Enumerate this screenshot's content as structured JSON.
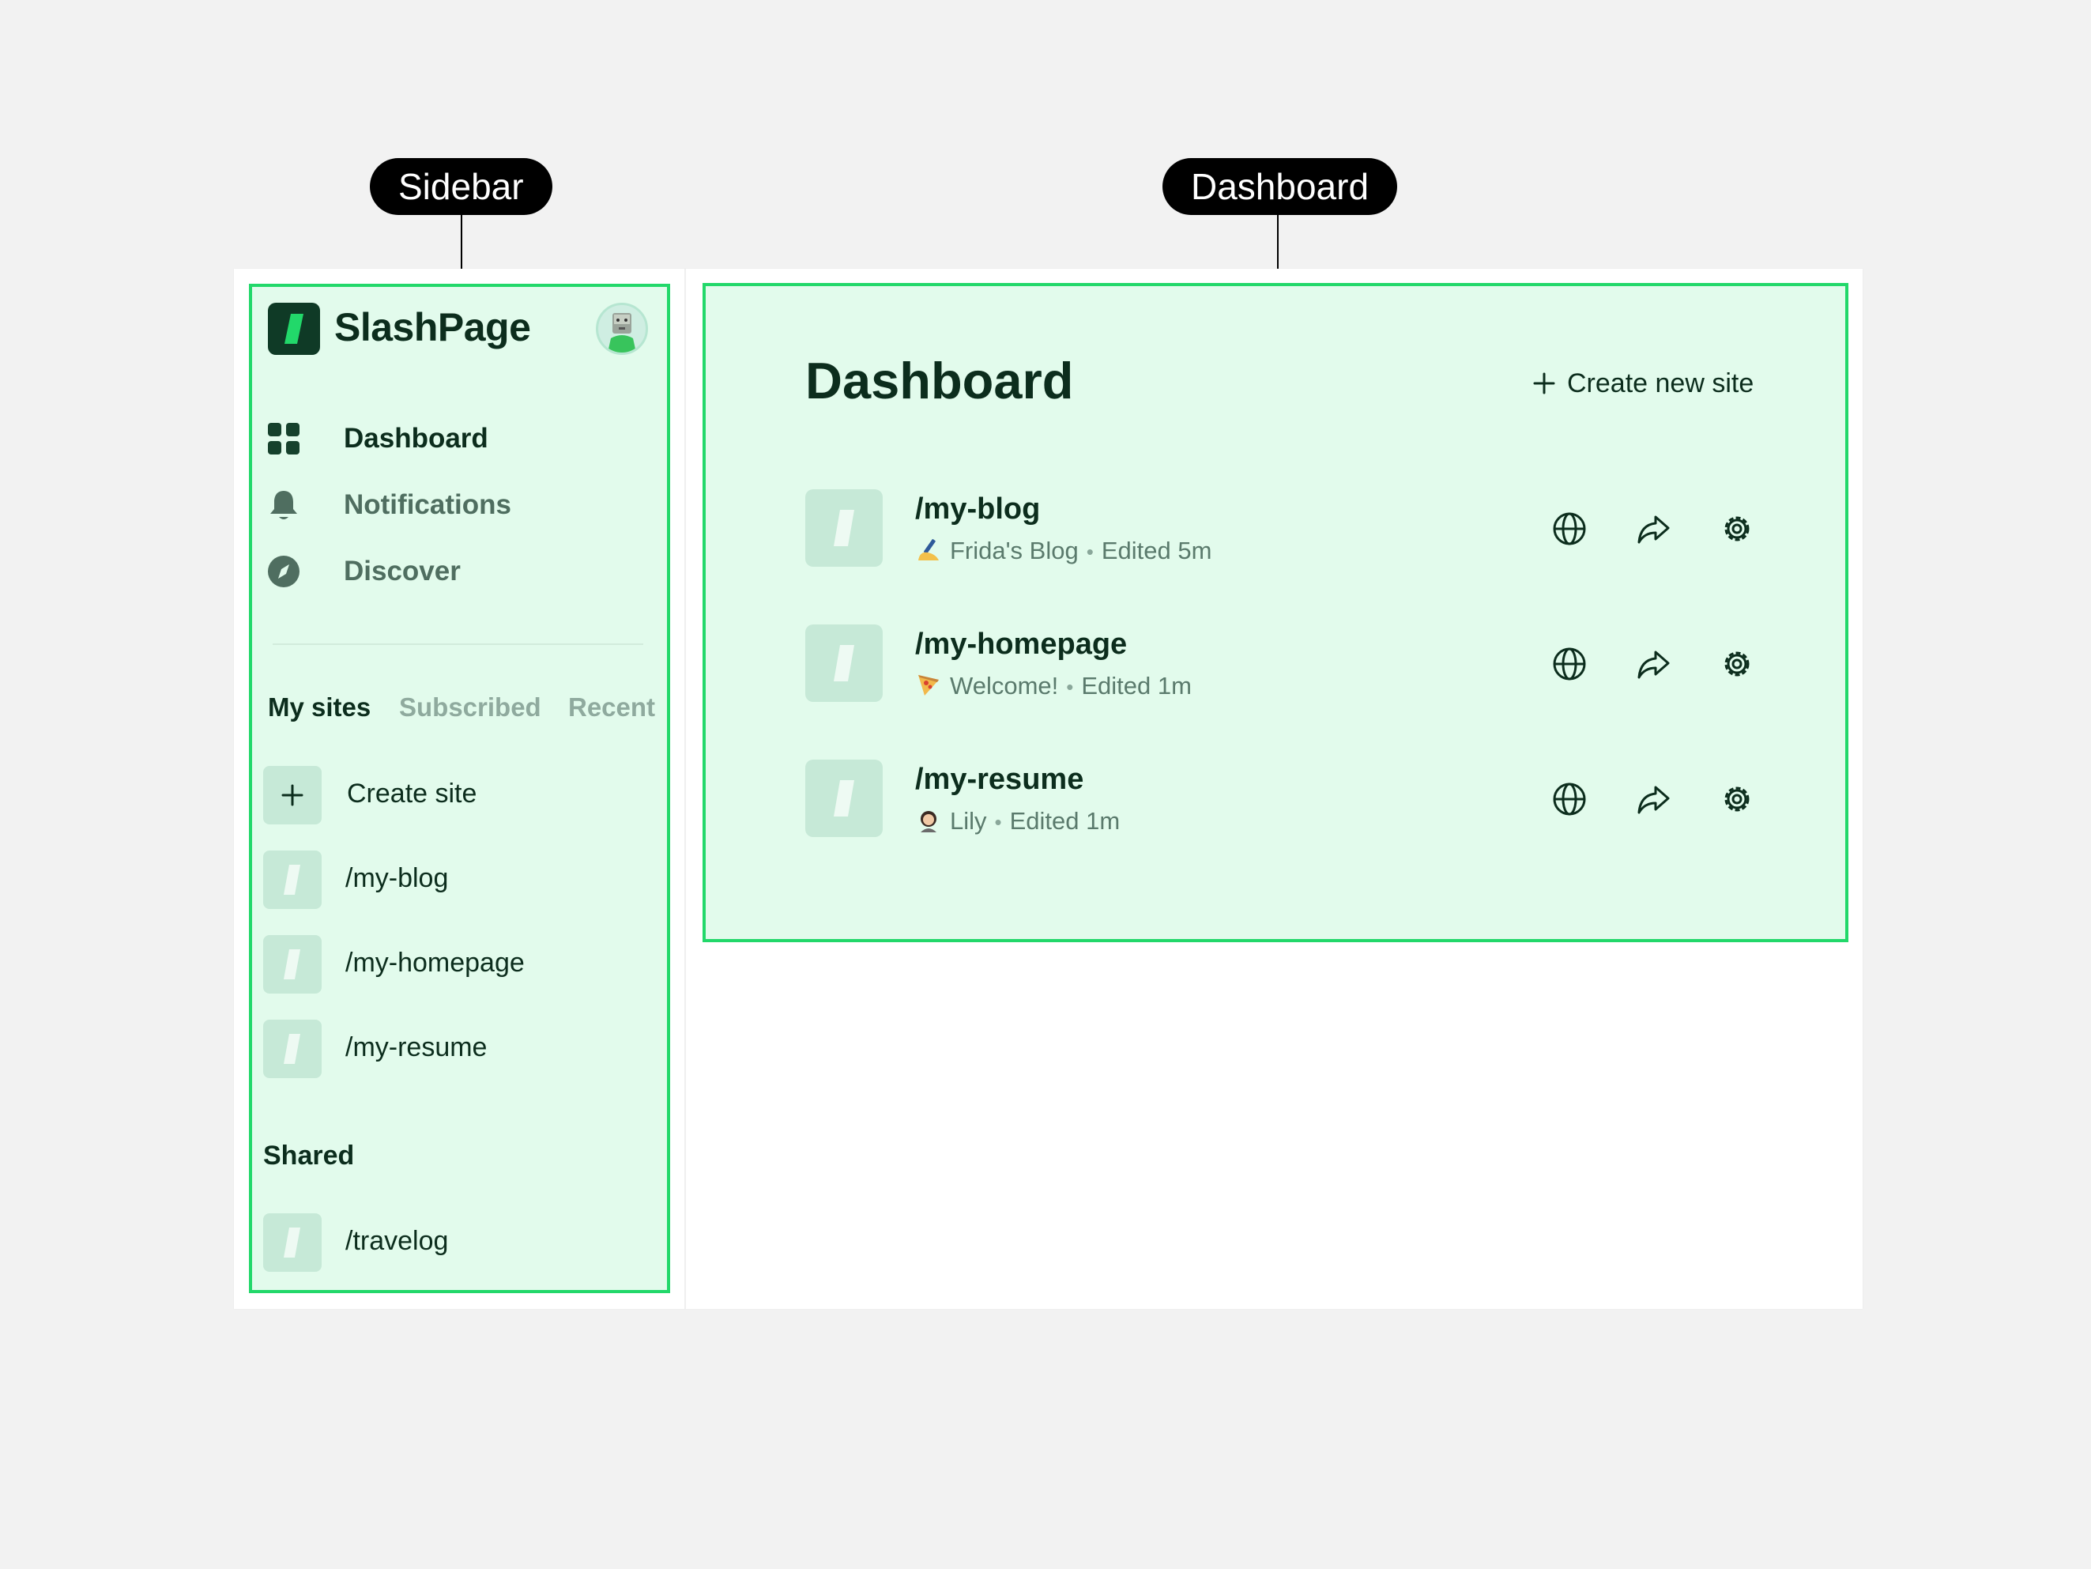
{
  "callouts": {
    "sidebar": "Sidebar",
    "dashboard": "Dashboard"
  },
  "sidebar": {
    "brand": "SlashPage",
    "nav": [
      {
        "label": "Dashboard",
        "icon": "grid-icon",
        "active": true
      },
      {
        "label": "Notifications",
        "icon": "bell-icon",
        "active": false
      },
      {
        "label": "Discover",
        "icon": "compass-icon",
        "active": false
      }
    ],
    "tabs": [
      {
        "label": "My sites",
        "active": true
      },
      {
        "label": "Subscribed",
        "active": false
      },
      {
        "label": "Recent",
        "active": false
      }
    ],
    "create_site": "Create site",
    "my_sites": [
      "/my-blog",
      "/my-homepage",
      "/my-resume"
    ],
    "shared_label": "Shared",
    "shared_sites": [
      "/travelog"
    ]
  },
  "dashboard": {
    "title": "Dashboard",
    "create_button": "Create new site",
    "sites": [
      {
        "path": "/my-blog",
        "emoji": "writing-hand",
        "site_title": "Frida's Blog",
        "edited": "Edited 5m"
      },
      {
        "path": "/my-homepage",
        "emoji": "pizza",
        "site_title": "Welcome!",
        "edited": "Edited 1m"
      },
      {
        "path": "/my-resume",
        "emoji": "person",
        "site_title": "Lily",
        "edited": "Edited 1m"
      }
    ],
    "actions": [
      "globe-icon",
      "share-icon",
      "gear-icon"
    ]
  },
  "colors": {
    "panel_bg": "#e2fbec",
    "panel_border": "#22d86a",
    "brand_dark": "#0f3a26",
    "text_primary": "#0c2d1d",
    "text_muted": "#5a7a6c"
  }
}
